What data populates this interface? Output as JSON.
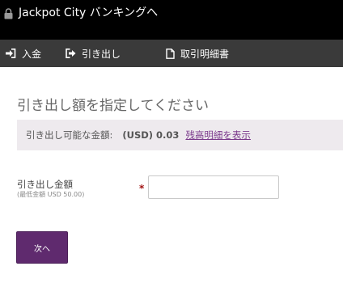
{
  "header": {
    "title": "Jackpot City バンキングへ",
    "lock_icon": "lock-icon"
  },
  "nav": {
    "deposit": {
      "label": "入金",
      "icon": "deposit-icon"
    },
    "withdraw": {
      "label": "引き出し",
      "icon": "withdraw-icon"
    },
    "history": {
      "label": "取引明細書",
      "icon": "document-icon"
    }
  },
  "main": {
    "heading": "引き出し額を指定してください",
    "available_label": "引き出し可能な金額:",
    "available_value": "(USD) 0.03",
    "balance_link": "残高明細を表示",
    "amount_label": "引き出し金額",
    "amount_hint": "(最低金額 USD 50.00)",
    "required_mark": "*",
    "amount_value": "",
    "next_label": "次へ"
  },
  "colors": {
    "titlebar_bg": "#000000",
    "navbar_bg": "#3a3a3a",
    "accent": "#5f2a6e",
    "link": "#7b3a8c",
    "info_bg": "#eeeaee"
  }
}
